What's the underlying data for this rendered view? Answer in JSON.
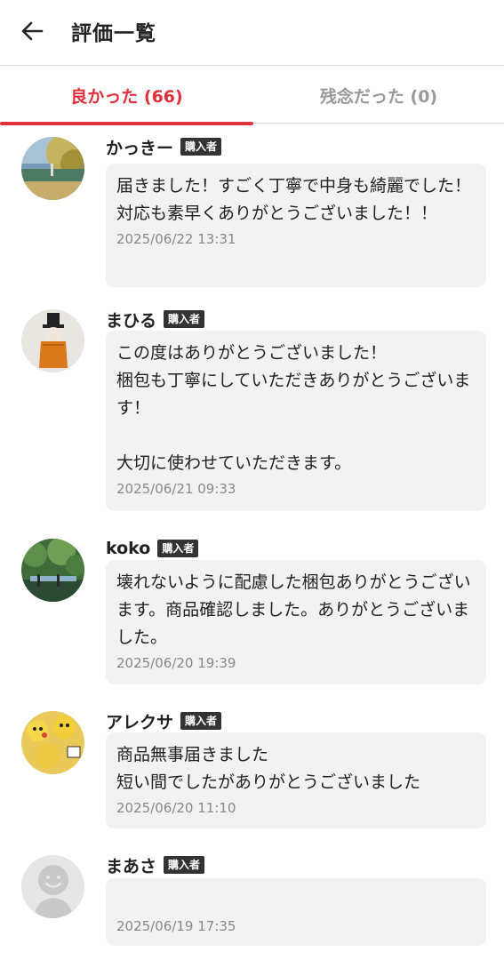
{
  "header": {
    "title": "評価一覧",
    "back_icon": "arrow-left-icon"
  },
  "tabs": [
    {
      "label": "良かった (66)",
      "active": true
    },
    {
      "label": "残念だった (0)",
      "active": false
    }
  ],
  "colors": {
    "accent": "#e0303b",
    "inactive_tab": "#999999",
    "bubble_bg": "#f2f2f2",
    "badge_bg": "#333333"
  },
  "reviews": [
    {
      "username": "かっきー",
      "badge": "購入者",
      "comment": "届きました！すごく丁寧で中身も綺麗でした！対応も素早くありがとうございました！！",
      "date": "2025/06/22 13:31",
      "avatar": "landscape-painting-avatar"
    },
    {
      "username": "まひる",
      "badge": "購入者",
      "comment": "この度はありがとうございました！\n梱包も丁寧にしていただきありがとうございます！\n\n大切に使わせていただきます。",
      "date": "2025/06/21 09:33",
      "avatar": "figure-with-hat-avatar"
    },
    {
      "username": "koko",
      "badge": "購入者",
      "comment": "壊れないように配慮した梱包ありがとうございます。商品確認しました。ありがとうございました。",
      "date": "2025/06/20 19:39",
      "avatar": "garden-painting-avatar"
    },
    {
      "username": "アレクサ",
      "badge": "購入者",
      "comment": "商品無事届きました\n短い間でしたがありがとうございました",
      "date": "2025/06/20 11:10",
      "avatar": "yellow-character-avatar"
    },
    {
      "username": "まあさ",
      "badge": "購入者",
      "comment": "",
      "date": "2025/06/19 17:35",
      "avatar": "default-person-avatar"
    }
  ]
}
